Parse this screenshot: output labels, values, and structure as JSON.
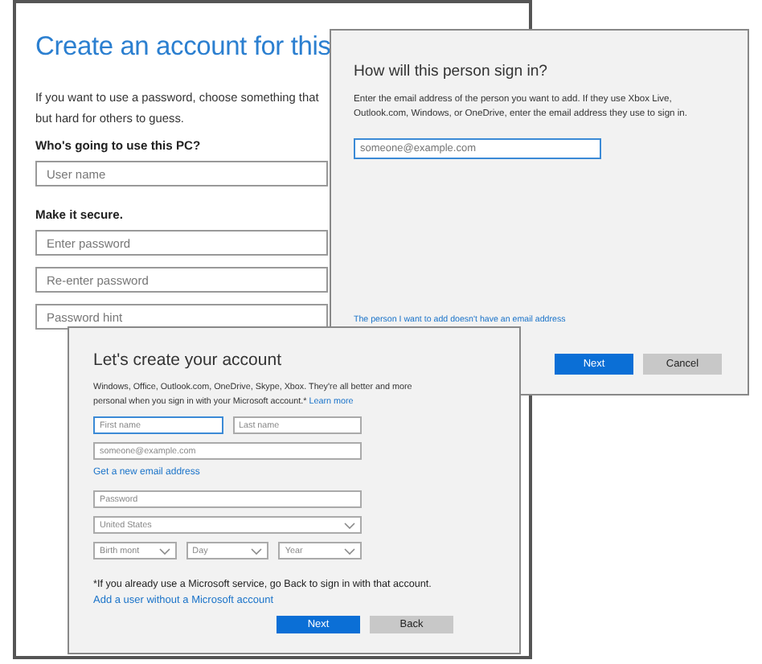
{
  "back_window": {
    "title": "Create an account for this",
    "intro": [
      "If you want to use a password, choose something that",
      "but hard for others to guess."
    ],
    "sections": [
      {
        "heading": "Who's going to use this PC?",
        "fields": [
          {
            "placeholder": "User name"
          }
        ]
      },
      {
        "heading": "Make it secure.",
        "fields": [
          {
            "placeholder": "Enter password"
          },
          {
            "placeholder": "Re-enter password"
          },
          {
            "placeholder": "Password hint"
          }
        ]
      }
    ]
  },
  "sign_in_dialog": {
    "title": "How will this person sign in?",
    "text": "Enter the email address of the person you want to add. If they use Xbox Live, Outlook.com, Windows, or OneDrive, enter the email address they use to sign in.",
    "email_field": {
      "placeholder": "someone@example.com",
      "focused": true
    },
    "link": "The person I want to add doesn't have an email address",
    "buttons": [
      {
        "label": "Next",
        "primary": true
      },
      {
        "label": "Cancel",
        "primary": false
      }
    ]
  },
  "create_account_dialog": {
    "title": "Let's create your account",
    "text": "Windows, Office, Outlook.com, OneDrive, Skype, Xbox. They're all better and more personal when you sign in with your Microsoft account.*",
    "text_link": "Learn more",
    "items": [
      {
        "kind": "fields",
        "fields": [
          {
            "kind": "text",
            "placeholder": "First name",
            "focused": true
          },
          {
            "kind": "text",
            "placeholder": "Last name",
            "focused": false
          }
        ]
      },
      {
        "kind": "fields",
        "fields": [
          {
            "kind": "text",
            "placeholder": "someone@example.com",
            "focused": false
          }
        ]
      },
      {
        "kind": "link",
        "text": "Get a new email address"
      },
      {
        "kind": "fields",
        "fields": [
          {
            "kind": "text",
            "placeholder": "Password",
            "focused": false
          }
        ]
      },
      {
        "kind": "fields",
        "fields": [
          {
            "kind": "select",
            "value": "United States",
            "focused": false
          }
        ]
      },
      {
        "kind": "fields",
        "fields": [
          {
            "kind": "select",
            "value": "Birth mont",
            "focused": false
          },
          {
            "kind": "select",
            "value": "Day",
            "focused": false
          },
          {
            "kind": "select",
            "value": "Year",
            "focused": false
          }
        ]
      }
    ],
    "note": "*If you already use a Microsoft service, go Back to sign in with that account.",
    "link": "Add a user without a Microsoft account",
    "buttons": [
      {
        "label": "Next",
        "primary": true
      },
      {
        "label": "Back",
        "primary": false
      }
    ]
  }
}
